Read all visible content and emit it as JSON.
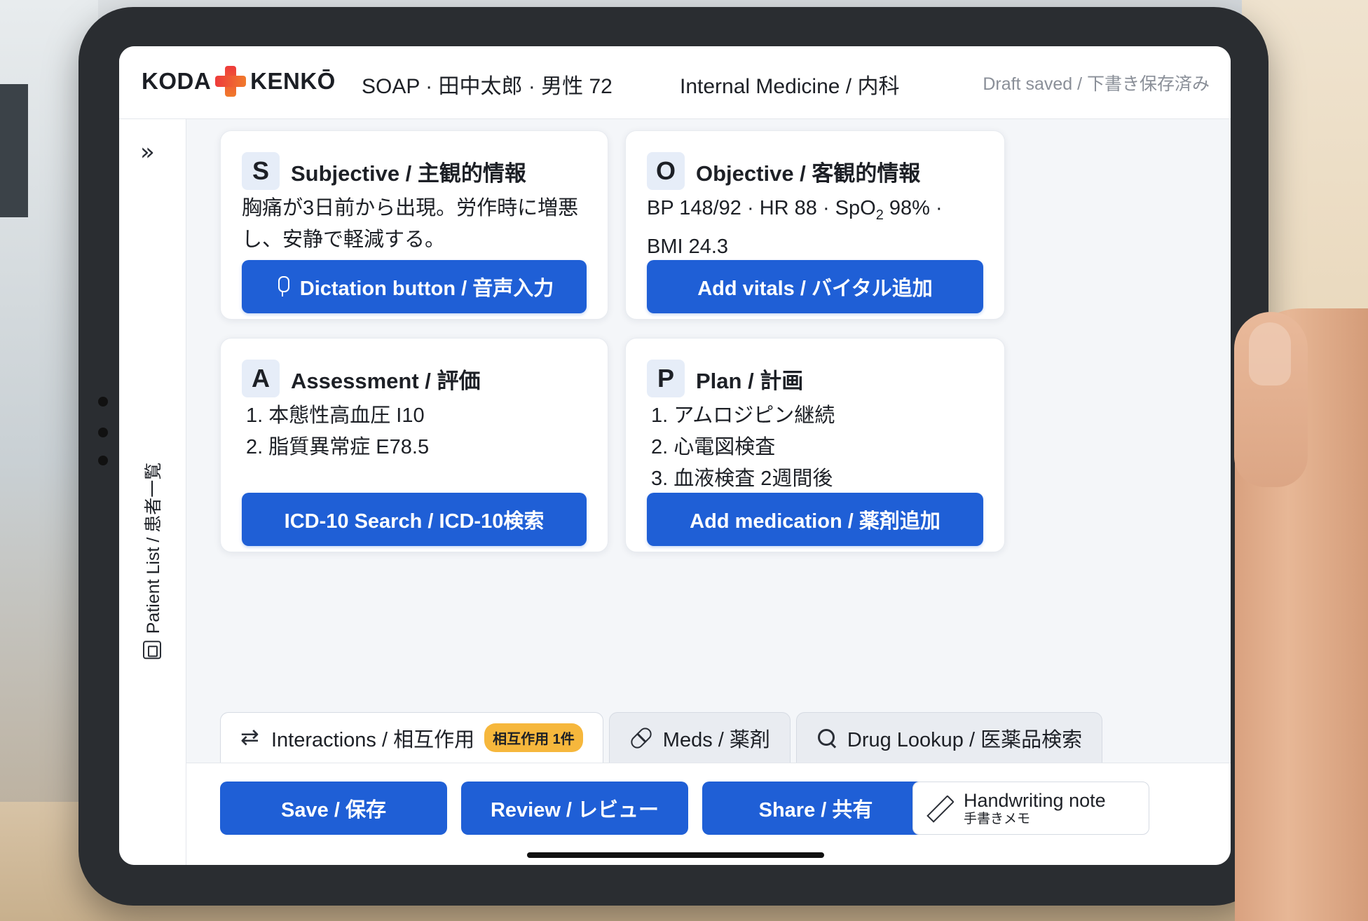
{
  "header": {
    "logo_left": "KODA",
    "logo_right": "KENKŌ",
    "patient": "SOAP · 田中太郎 · 男性 72",
    "department": "Internal Medicine / 内科",
    "status": "Draft saved / 下書き保存済み"
  },
  "sidebar": {
    "expand_icon": "double-chevron-right-icon",
    "label": "Patient List / 患者一覧",
    "icon": "patient-list-icon"
  },
  "cards": {
    "subjective": {
      "letter": "S",
      "title": "Subjective / 主観的情報",
      "text": "胸痛が3日前から出現。労作時に増悪し、安静で軽減する。",
      "button": "Dictation button / 音声入力"
    },
    "objective": {
      "letter": "O",
      "title": "Objective / 客観的情報",
      "vitals_a": "BP 148/92 · HR 88 · SpO",
      "vitals_sub": "2",
      "vitals_b": " 98% · BMI 24.3",
      "button": "Add vitals / バイタル追加"
    },
    "assessment": {
      "letter": "A",
      "title": "Assessment / 評価",
      "items": [
        "1. 本態性高血圧 I10",
        "2. 脂質異常症 E78.5"
      ],
      "button": "ICD-10 Search / ICD-10検索"
    },
    "plan": {
      "letter": "P",
      "title": "Plan / 計画",
      "items": [
        "1. アムロジピン継続",
        "2. 心電図検査",
        "3. 血液検査 2週間後"
      ],
      "button": "Add medication / 薬剤追加"
    }
  },
  "tabs": [
    {
      "label": "Interactions / 相互作用",
      "badge": "相互作用 1件",
      "icon": "swap-arrows-icon"
    },
    {
      "label": "Meds / 薬剤",
      "icon": "pill-icon"
    },
    {
      "label": "Drug Lookup / 医薬品検索",
      "icon": "search-icon"
    }
  ],
  "actions": {
    "save": "Save / 保存",
    "review": "Review / レビュー",
    "share": "Share / 共有",
    "handwriting_main": "Handwriting note",
    "handwriting_sub": "手書きメモ"
  },
  "colors": {
    "primary": "#1f5fd6",
    "badge": "#f6b73c",
    "logo_cross": "#ee3b3b"
  }
}
